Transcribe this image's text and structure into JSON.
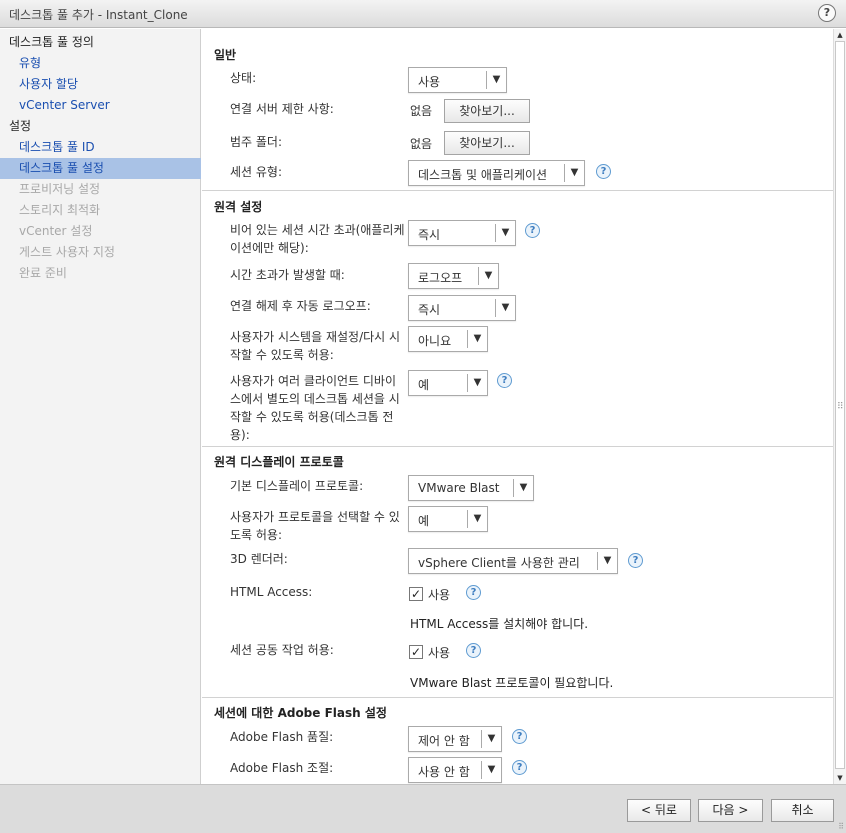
{
  "window": {
    "title": "데스크톱 풀 추가 - Instant_Clone",
    "help_icon": "?"
  },
  "sidebar": {
    "items": [
      {
        "label": "데스크톱 풀 정의"
      },
      {
        "label": "유형"
      },
      {
        "label": "사용자 할당"
      },
      {
        "label": "vCenter Server"
      },
      {
        "label": "설정"
      },
      {
        "label": "데스크톱 풀 ID"
      },
      {
        "label": "데스크톱 풀 설정"
      },
      {
        "label": "프로비저닝 설정"
      },
      {
        "label": "스토리지 최적화"
      },
      {
        "label": "vCenter 설정"
      },
      {
        "label": "게스트 사용자 지정"
      },
      {
        "label": "완료 준비"
      }
    ]
  },
  "general": {
    "title": "일반",
    "state": {
      "label": "상태:",
      "value": "사용"
    },
    "conn_server_limit": {
      "label": "연결 서버 제한 사항:",
      "value": "없음",
      "button": "찾아보기..."
    },
    "category_folder": {
      "label": "범주 폴더:",
      "value": "없음",
      "button": "찾아보기..."
    },
    "session_type": {
      "label": "세션 유형:",
      "value": "데스크톱 및 애플리케이션"
    }
  },
  "remote": {
    "title": "원격 설정",
    "empty_session_timeout": {
      "label": "비어 있는 세션 시간 초과(애플리케이션에만 해당):",
      "value": "즉시"
    },
    "when_timeout": {
      "label": "시간 초과가 발생할 때:",
      "value": "로그오프"
    },
    "auto_logoff": {
      "label": "연결 해제 후 자동 로그오프:",
      "value": "즉시"
    },
    "allow_reset": {
      "label": "사용자가 시스템을 재설정/다시 시작할 수 있도록 허용:",
      "value": "아니요"
    },
    "allow_separate": {
      "label": "사용자가 여러 클라이언트 디바이스에서 별도의 데스크톱 세션을 시작할 수 있도록 허용(데스크톱 전용):",
      "value": "예"
    }
  },
  "display": {
    "title": "원격 디스플레이 프로토콜",
    "default_protocol": {
      "label": "기본 디스플레이 프로토콜:",
      "value": "VMware Blast"
    },
    "allow_choose": {
      "label": "사용자가 프로토콜을 선택할 수 있도록 허용:",
      "value": "예"
    },
    "renderer": {
      "label": "3D 렌더러:",
      "value": "vSphere Client를 사용한 관리"
    },
    "html_access": {
      "label": "HTML Access:",
      "checkbox_label": "사용",
      "checked": true,
      "note": "HTML Access를 설치해야 합니다."
    },
    "collab": {
      "label": "세션 공동 작업 허용:",
      "checkbox_label": "사용",
      "checked": true,
      "note": "VMware Blast 프로토콜이 필요합니다."
    }
  },
  "flash": {
    "title_prefix": "세션에 대한 ",
    "title_strong": "Adobe Flash",
    "title_suffix": " 설정",
    "quality": {
      "label": "Adobe Flash 품질:",
      "value": "제어 안 함"
    },
    "throttling": {
      "label": "Adobe Flash 조절:",
      "value": "사용 안 함"
    }
  },
  "footer": {
    "back": "< 뒤로",
    "next": "다음 >",
    "cancel": "취소"
  },
  "icons": {
    "dropdown_arrow": "▼",
    "help": "?",
    "check": "✓",
    "scroll_up": "▲",
    "scroll_down": "▼",
    "grip": "⠿"
  }
}
